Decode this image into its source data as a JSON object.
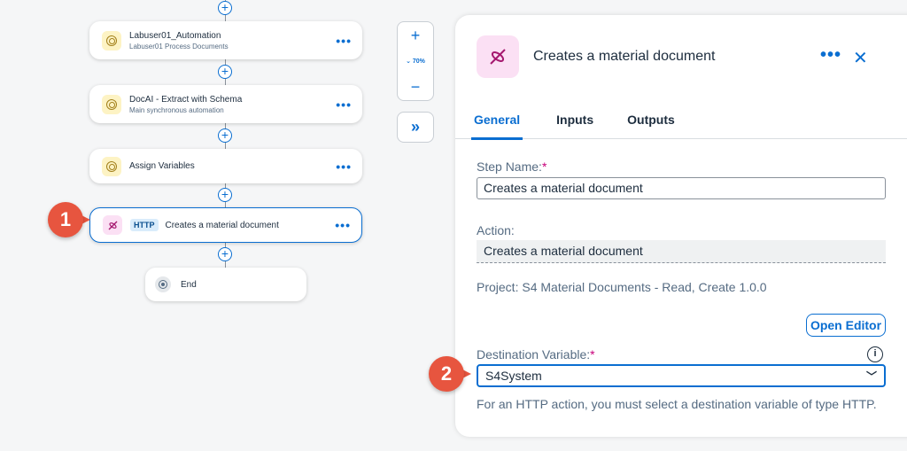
{
  "flow": {
    "nodes": [
      {
        "title": "Labuser01_Automation",
        "subtitle": "Labuser01 Process Documents"
      },
      {
        "title": "DocAI - Extract with Schema",
        "subtitle": "Main synchronous automation"
      },
      {
        "title": "Assign Variables",
        "subtitle": ""
      },
      {
        "badge": "HTTP",
        "title": "Creates a material document",
        "subtitle": ""
      }
    ],
    "end_label": "End",
    "more_label": "•••",
    "add_label": "+"
  },
  "callouts": {
    "one": "1",
    "two": "2"
  },
  "zoom": {
    "in": "+",
    "level": "70%",
    "out": "−",
    "expand": "»"
  },
  "panel": {
    "title": "Creates a material document",
    "more": "•••",
    "close": "✕",
    "tabs": [
      "General",
      "Inputs",
      "Outputs"
    ],
    "step_name_label": "Step Name:",
    "step_name_value": "Creates a material document",
    "required_mark": "*",
    "action_label": "Action:",
    "action_value": "Creates a material document",
    "project": "Project: S4 Material Documents - Read, Create 1.0.0",
    "open_editor": "Open Editor",
    "destination_label": "Destination Variable:",
    "destination_value": "S4System",
    "info_icon": "i",
    "hint": "For an HTTP action, you must select a destination variable of type HTTP."
  },
  "colors": {
    "accent": "#0a6ed1",
    "callout": "#e7553f",
    "required": "#c8007a"
  }
}
